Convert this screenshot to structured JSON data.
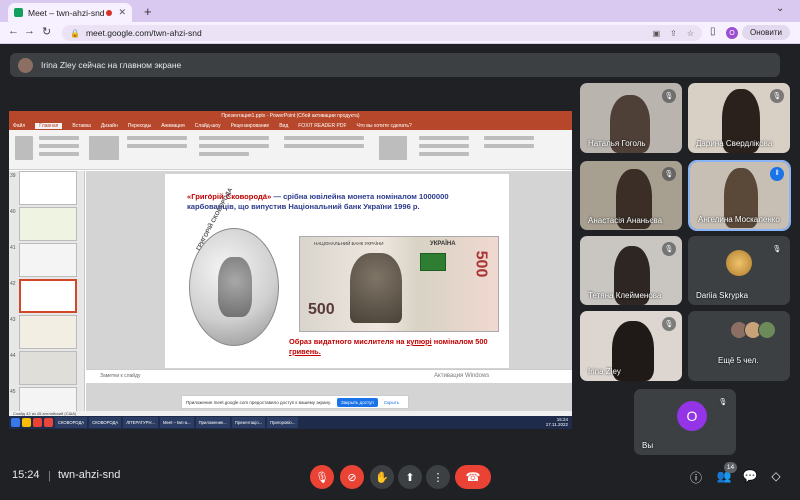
{
  "browser": {
    "tab_title": "Meet – twn-ahzi-snd",
    "tab_close": "✕",
    "new_tab": "+",
    "tab_menu": "⌄",
    "url": "meet.google.com/twn-ahzi-snd",
    "profile_initial": "O",
    "update_label": "Оновити"
  },
  "banner": {
    "text": "Irina Zley сейчас на главном экране"
  },
  "presentation": {
    "app_title": "Презентация1.pptx - PowerPoint (Сбой активации продукта)",
    "ribbon_tabs": [
      "Файл",
      "Главная",
      "Вставка",
      "Дизайн",
      "Переходы",
      "Анимация",
      "Слайд-шоу",
      "Рецензирование",
      "Вид",
      "FOXIT READER PDF",
      "Что вы хотите сделать?"
    ],
    "thumb_numbers": [
      "39",
      "40",
      "41",
      "42",
      "43",
      "44",
      "45"
    ],
    "slide_quote": "«Григо́рій Сковорода́»",
    "slide_text": " — срібна ювілейна монета номіналом 1000000 карбованців, що випустив Національний банк України 1996 р.",
    "coin_text": "ГРИГОРІЙ СКОВОРОДА",
    "banknote_bank": "НАЦІОНАЛЬНИЙ БАНК УКРАЇНИ",
    "banknote_country": "УКРАЇНА",
    "banknote_value": "500",
    "caption_main": "Образ видатного мислителя на ",
    "caption_underline": "купюрі",
    "caption_mid": " номіналом 500 ",
    "caption_end": "гривень.",
    "notes_placeholder": "Заметки к слайду",
    "windows_watermark": "Активация Windows",
    "share_message": "Приложение meet.google.com предоставило доступ к вашему экрану.",
    "share_stop": "Закрыть доступ",
    "share_hide": "Скрыть",
    "status_text": "Слайд 42 из 45   английский (США)",
    "taskbar_items": [
      "СКОВОРОДА",
      "СКОВОРОДА",
      "ЛІТЕРАТУРН...",
      "Meet – twn-a...",
      "Приложение...",
      "Презентаціо...",
      "Пригоровіо..."
    ],
    "taskbar_time": "15:24",
    "taskbar_date": "17.11.2022"
  },
  "participants": [
    {
      "name": "Наталья Гоголь",
      "muted": true
    },
    {
      "name": "Дарина Свердлікова",
      "muted": true
    },
    {
      "name": "Анастасія Ананьєва",
      "muted": true
    },
    {
      "name": "Ангелина Москаленко",
      "muted": false,
      "speaking": true
    },
    {
      "name": "Тетяна Клейменова",
      "muted": true
    },
    {
      "name": "Dariia Skrypka",
      "muted": true
    },
    {
      "name": "Irina Zley",
      "muted": true
    },
    {
      "name": "Ещё 5 чел.",
      "muted": false
    },
    {
      "name": "Вы",
      "initial": "O",
      "muted": true
    }
  ],
  "bottom_bar": {
    "time": "15:24",
    "separator": "|",
    "meeting_code": "twn-ahzi-snd",
    "people_count": "14"
  },
  "icons": {
    "mic_off": "🎙",
    "cam_off": "⊘",
    "hand": "✋",
    "present": "⬆",
    "more": "⋮",
    "hangup": "☎",
    "info": "ⓘ",
    "people": "👥",
    "chat": "💬",
    "activities": "◇"
  },
  "colors": {
    "meet_bg": "#202124",
    "hangup_red": "#ea4335",
    "accent_blue": "#1a73e8",
    "you_avatar": "#9334e6",
    "powerpoint": "#b7472a"
  }
}
